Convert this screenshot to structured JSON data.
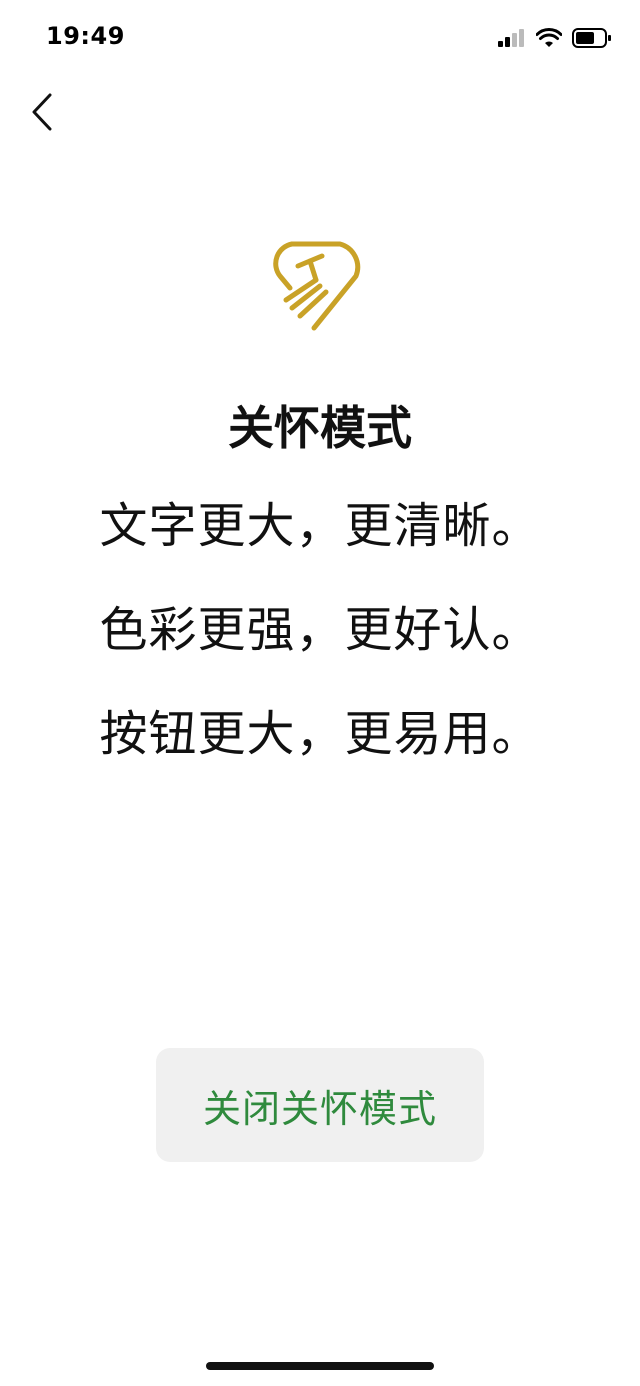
{
  "status_bar": {
    "time": "19:49",
    "icons": [
      "cellular-signal-icon",
      "wifi-icon",
      "battery-icon"
    ]
  },
  "nav": {
    "back_icon": "chevron-left-icon"
  },
  "header": {
    "icon": "care-heart-handshake-icon",
    "icon_color": "#C9A227",
    "title": "关怀模式"
  },
  "features": [
    "文字更大，更清晰。",
    "色彩更强，更好认。",
    "按钮更大，更易用。"
  ],
  "actions": {
    "exit_label": "关闭关怀模式",
    "exit_color": "#2F8A3D"
  }
}
